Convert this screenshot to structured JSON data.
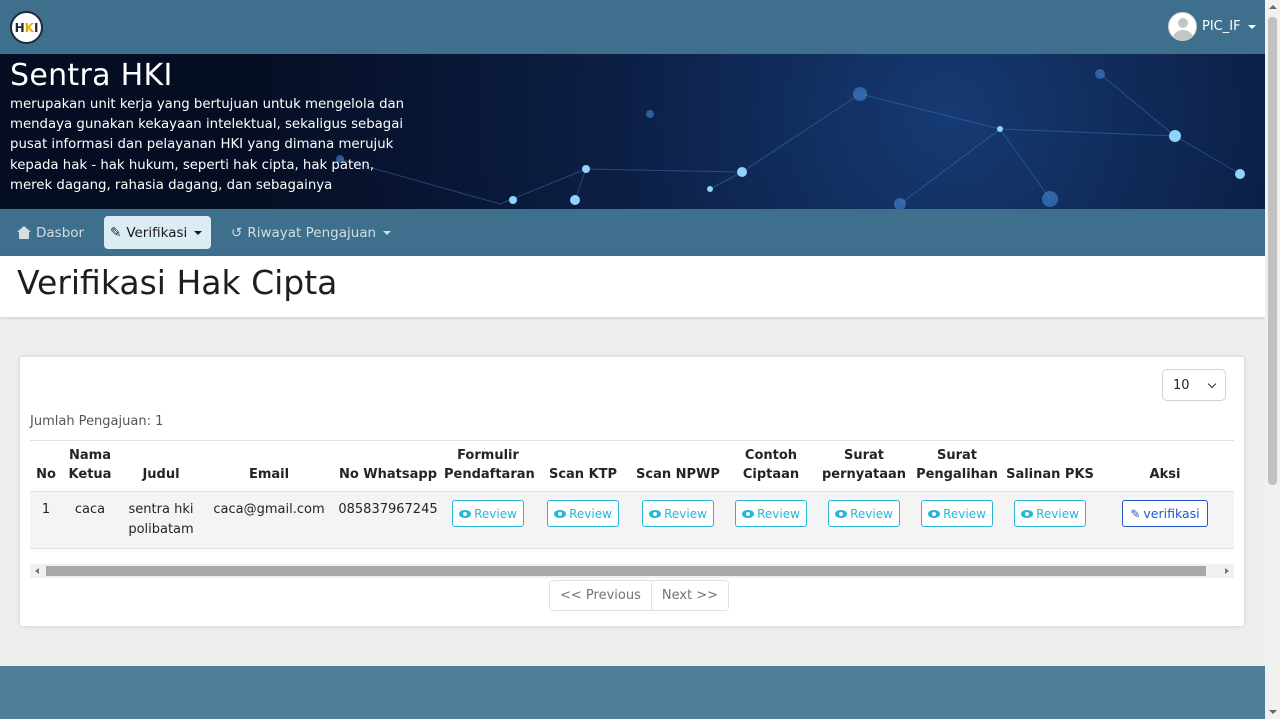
{
  "header": {
    "logo_text": "HKI",
    "user_name": "PIC_IF"
  },
  "hero": {
    "title": "Sentra HKI",
    "description": "merupakan unit kerja yang bertujuan untuk mengelola dan mendaya gunakan kekayaan intelektual, sekaligus sebagai pusat informasi dan pelayanan HKI yang dimana merujuk kepada hak - hak hukum, seperti hak cipta, hak paten, merek dagang, rahasia dagang, dan sebagainya"
  },
  "nav": {
    "items": [
      {
        "label": "Dasbor",
        "icon": "home-icon",
        "active": false
      },
      {
        "label": "Verifikasi",
        "icon": "file-signature-icon",
        "active": true
      },
      {
        "label": "Riwayat Pengajuan",
        "icon": "history-icon",
        "active": false
      }
    ]
  },
  "page": {
    "title": "Verifikasi Hak Cipta",
    "per_page": "10",
    "count_label": "Jumlah Pengajuan: 1"
  },
  "table": {
    "headers": [
      "No",
      "Nama Ketua",
      "Judul",
      "Email",
      "No Whatsapp",
      "Formulir Pendaftaran",
      "Scan KTP",
      "Scan NPWP",
      "Contoh Ciptaan",
      "Surat pernyataan",
      "Surat Pengalihan",
      "Salinan PKS",
      "Aksi"
    ],
    "rows": [
      {
        "no": "1",
        "nama_ketua": "caca",
        "judul": "sentra hki polibatam",
        "email": "caca@gmail.com",
        "whatsapp": "085837967245",
        "review_label": "Review",
        "action_label": "verifikasi"
      }
    ]
  },
  "pagination": {
    "previous": "<< Previous",
    "next": "Next >>"
  },
  "colors": {
    "topbar": "#3e6f8c",
    "review_accent": "#27b6d5",
    "verify_accent": "#2356c9",
    "footer": "#4e7e99"
  }
}
